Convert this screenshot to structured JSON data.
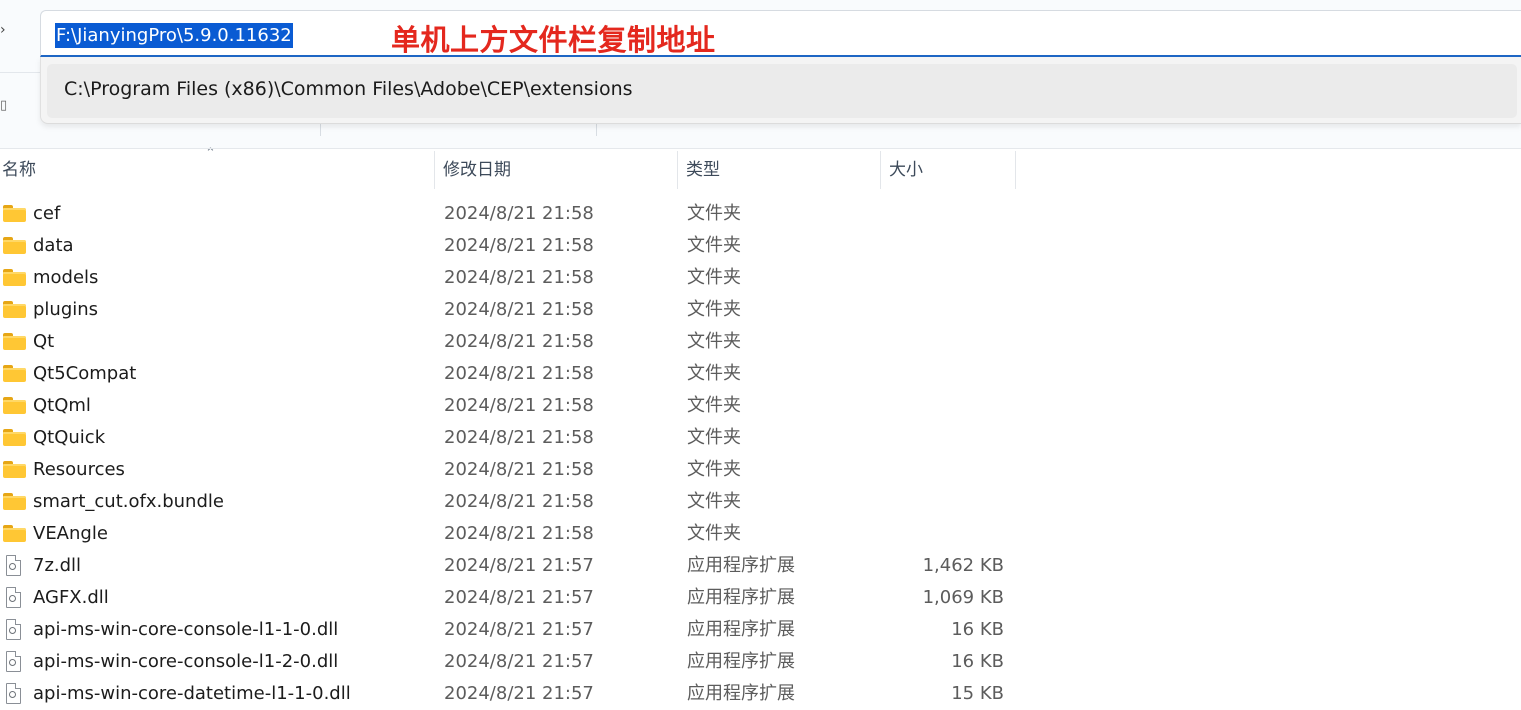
{
  "address_bar": {
    "path": "F:\\JianyingPro\\5.9.0.11632",
    "annotation": "单机上方文件栏复制地址"
  },
  "suggestions": [
    {
      "path": "C:\\Program Files (x86)\\Common Files\\Adobe\\CEP\\extensions"
    }
  ],
  "columns": {
    "name": "名称",
    "modified": "修改日期",
    "type": "类型",
    "size": "大小"
  },
  "files": [
    {
      "name": "cef",
      "modified": "2024/8/21 21:58",
      "type": "文件夹",
      "size": "",
      "icon": "folder-icon"
    },
    {
      "name": "data",
      "modified": "2024/8/21 21:58",
      "type": "文件夹",
      "size": "",
      "icon": "folder-icon"
    },
    {
      "name": "models",
      "modified": "2024/8/21 21:58",
      "type": "文件夹",
      "size": "",
      "icon": "folder-icon"
    },
    {
      "name": "plugins",
      "modified": "2024/8/21 21:58",
      "type": "文件夹",
      "size": "",
      "icon": "folder-icon"
    },
    {
      "name": "Qt",
      "modified": "2024/8/21 21:58",
      "type": "文件夹",
      "size": "",
      "icon": "folder-icon"
    },
    {
      "name": "Qt5Compat",
      "modified": "2024/8/21 21:58",
      "type": "文件夹",
      "size": "",
      "icon": "folder-icon"
    },
    {
      "name": "QtQml",
      "modified": "2024/8/21 21:58",
      "type": "文件夹",
      "size": "",
      "icon": "folder-icon"
    },
    {
      "name": "QtQuick",
      "modified": "2024/8/21 21:58",
      "type": "文件夹",
      "size": "",
      "icon": "folder-icon"
    },
    {
      "name": "Resources",
      "modified": "2024/8/21 21:58",
      "type": "文件夹",
      "size": "",
      "icon": "folder-icon"
    },
    {
      "name": "smart_cut.ofx.bundle",
      "modified": "2024/8/21 21:58",
      "type": "文件夹",
      "size": "",
      "icon": "folder-icon"
    },
    {
      "name": "VEAngle",
      "modified": "2024/8/21 21:58",
      "type": "文件夹",
      "size": "",
      "icon": "folder-icon"
    },
    {
      "name": "7z.dll",
      "modified": "2024/8/21 21:57",
      "type": "应用程序扩展",
      "size": "1,462 KB",
      "icon": "dll-file-icon"
    },
    {
      "name": "AGFX.dll",
      "modified": "2024/8/21 21:57",
      "type": "应用程序扩展",
      "size": "1,069 KB",
      "icon": "dll-file-icon"
    },
    {
      "name": "api-ms-win-core-console-l1-1-0.dll",
      "modified": "2024/8/21 21:57",
      "type": "应用程序扩展",
      "size": "16 KB",
      "icon": "dll-file-icon"
    },
    {
      "name": "api-ms-win-core-console-l1-2-0.dll",
      "modified": "2024/8/21 21:57",
      "type": "应用程序扩展",
      "size": "16 KB",
      "icon": "dll-file-icon"
    },
    {
      "name": "api-ms-win-core-datetime-l1-1-0.dll",
      "modified": "2024/8/21 21:57",
      "type": "应用程序扩展",
      "size": "15 KB",
      "icon": "dll-file-icon"
    }
  ],
  "colors": {
    "selection": "#0a5bd3",
    "annotation": "#e4281e",
    "folder": "#ffc734",
    "focus_underline": "#1f67c5"
  }
}
